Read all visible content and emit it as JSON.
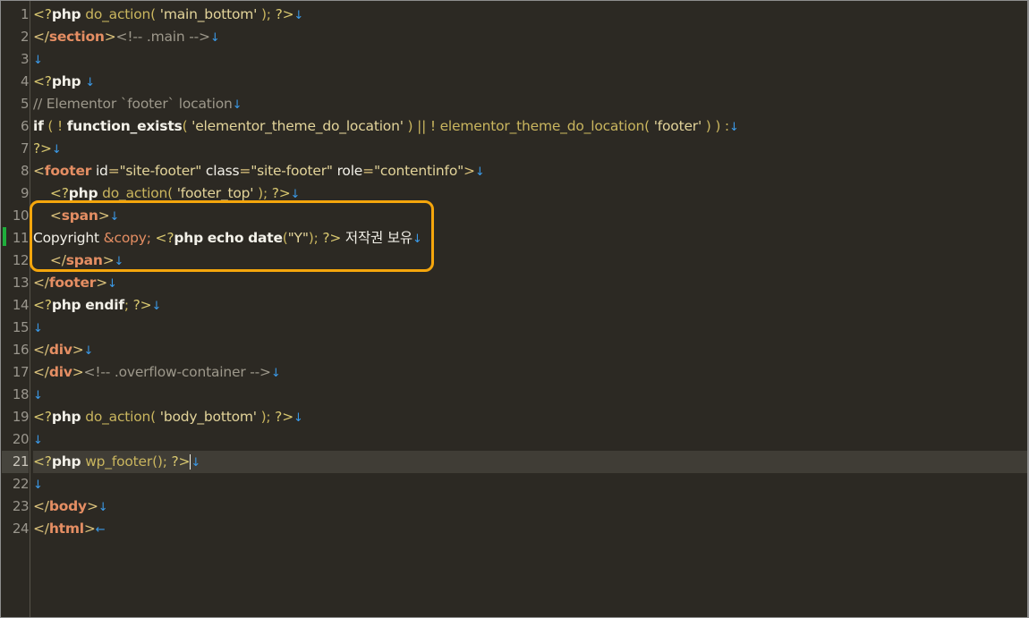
{
  "editor": {
    "active_line": 21,
    "line_numbers": [
      "1",
      "2",
      "3",
      "4",
      "5",
      "6",
      "7",
      "8",
      "9",
      "10",
      "11",
      "12",
      "13",
      "14",
      "15",
      "16",
      "17",
      "18",
      "19",
      "20",
      "21",
      "22",
      "23",
      "24"
    ],
    "eol_glyph": "↓",
    "eof_glyph": "←",
    "lines": [
      {
        "tokens": [
          {
            "c": "pt",
            "t": "<?"
          },
          {
            "c": "kw",
            "t": "php"
          },
          {
            "c": "fn",
            "t": " do_action( "
          },
          {
            "c": "str",
            "t": "'main_bottom'"
          },
          {
            "c": "fn",
            "t": " ); "
          },
          {
            "c": "pt",
            "t": "?>"
          }
        ]
      },
      {
        "tokens": [
          {
            "c": "tg",
            "t": "</"
          },
          {
            "c": "tn",
            "t": "section"
          },
          {
            "c": "tg",
            "t": ">"
          },
          {
            "c": "cm",
            "t": "<!-- .main -->"
          }
        ]
      },
      {
        "tokens": []
      },
      {
        "tokens": [
          {
            "c": "pt",
            "t": "<?"
          },
          {
            "c": "kw",
            "t": "php"
          },
          {
            "c": "tx",
            "t": " "
          }
        ]
      },
      {
        "tokens": [
          {
            "c": "cm",
            "t": "// Elementor `footer` location"
          }
        ]
      },
      {
        "tokens": [
          {
            "c": "kw",
            "t": "if"
          },
          {
            "c": "fn",
            "t": " ( ! "
          },
          {
            "c": "bfn",
            "t": "function_exists"
          },
          {
            "c": "fn",
            "t": "( "
          },
          {
            "c": "str",
            "t": "'elementor_theme_do_location'"
          },
          {
            "c": "fn",
            "t": " ) || ! elementor_theme_do_location( "
          },
          {
            "c": "str",
            "t": "'footer'"
          },
          {
            "c": "fn",
            "t": " ) ) :"
          }
        ]
      },
      {
        "tokens": [
          {
            "c": "pt",
            "t": "?>"
          }
        ]
      },
      {
        "tokens": [
          {
            "c": "tg",
            "t": "<"
          },
          {
            "c": "tn",
            "t": "footer"
          },
          {
            "c": "an",
            "t": " id"
          },
          {
            "c": "tg",
            "t": "="
          },
          {
            "c": "av",
            "t": "\"site-footer\""
          },
          {
            "c": "an",
            "t": " class"
          },
          {
            "c": "tg",
            "t": "="
          },
          {
            "c": "av",
            "t": "\"site-footer\""
          },
          {
            "c": "an",
            "t": " role"
          },
          {
            "c": "tg",
            "t": "="
          },
          {
            "c": "av",
            "t": "\"contentinfo\""
          },
          {
            "c": "tg",
            "t": ">"
          }
        ]
      },
      {
        "tokens": [
          {
            "c": "tx",
            "t": "    "
          },
          {
            "c": "pt",
            "t": "<?"
          },
          {
            "c": "kw",
            "t": "php"
          },
          {
            "c": "fn",
            "t": " do_action( "
          },
          {
            "c": "str",
            "t": "'footer_top'"
          },
          {
            "c": "fn",
            "t": " ); "
          },
          {
            "c": "pt",
            "t": "?>"
          }
        ]
      },
      {
        "tokens": [
          {
            "c": "tx",
            "t": "    "
          },
          {
            "c": "tg",
            "t": "<"
          },
          {
            "c": "tn",
            "t": "span"
          },
          {
            "c": "tg",
            "t": ">"
          }
        ]
      },
      {
        "tokens": [
          {
            "c": "tx",
            "t": "Copyright "
          },
          {
            "c": "ent",
            "t": "&copy;"
          },
          {
            "c": "tx",
            "t": " "
          },
          {
            "c": "pt",
            "t": "<?"
          },
          {
            "c": "kw",
            "t": "php"
          },
          {
            "c": "tx",
            "t": " "
          },
          {
            "c": "bfn",
            "t": "echo"
          },
          {
            "c": "tx",
            "t": " "
          },
          {
            "c": "bfn",
            "t": "date"
          },
          {
            "c": "fn",
            "t": "("
          },
          {
            "c": "str",
            "t": "\"Y\""
          },
          {
            "c": "fn",
            "t": "); "
          },
          {
            "c": "pt",
            "t": "?>"
          },
          {
            "c": "tx",
            "t": " 저작권 보유"
          }
        ]
      },
      {
        "tokens": [
          {
            "c": "tx",
            "t": "    "
          },
          {
            "c": "tg",
            "t": "</"
          },
          {
            "c": "tn",
            "t": "span"
          },
          {
            "c": "tg",
            "t": ">"
          }
        ]
      },
      {
        "tokens": [
          {
            "c": "tg",
            "t": "</"
          },
          {
            "c": "tn",
            "t": "footer"
          },
          {
            "c": "tg",
            "t": ">"
          }
        ]
      },
      {
        "tokens": [
          {
            "c": "pt",
            "t": "<?"
          },
          {
            "c": "kw",
            "t": "php"
          },
          {
            "c": "tx",
            "t": " "
          },
          {
            "c": "kw",
            "t": "endif"
          },
          {
            "c": "fn",
            "t": "; "
          },
          {
            "c": "pt",
            "t": "?>"
          }
        ]
      },
      {
        "tokens": []
      },
      {
        "tokens": [
          {
            "c": "tg",
            "t": "</"
          },
          {
            "c": "tn",
            "t": "div"
          },
          {
            "c": "tg",
            "t": ">"
          }
        ]
      },
      {
        "tokens": [
          {
            "c": "tg",
            "t": "</"
          },
          {
            "c": "tn",
            "t": "div"
          },
          {
            "c": "tg",
            "t": ">"
          },
          {
            "c": "cm",
            "t": "<!-- .overflow-container -->"
          }
        ]
      },
      {
        "tokens": []
      },
      {
        "tokens": [
          {
            "c": "pt",
            "t": "<?"
          },
          {
            "c": "kw",
            "t": "php"
          },
          {
            "c": "fn",
            "t": " do_action( "
          },
          {
            "c": "str",
            "t": "'body_bottom'"
          },
          {
            "c": "fn",
            "t": " ); "
          },
          {
            "c": "pt",
            "t": "?>"
          }
        ]
      },
      {
        "tokens": []
      },
      {
        "tokens": [
          {
            "c": "pt",
            "t": "<?"
          },
          {
            "c": "kw",
            "t": "php"
          },
          {
            "c": "fn",
            "t": " wp_footer(); "
          },
          {
            "c": "pt",
            "t": "?>"
          }
        ]
      },
      {
        "tokens": []
      },
      {
        "tokens": [
          {
            "c": "tg",
            "t": "</"
          },
          {
            "c": "tn",
            "t": "body"
          },
          {
            "c": "tg",
            "t": ">"
          }
        ]
      },
      {
        "tokens": [
          {
            "c": "tg",
            "t": "</"
          },
          {
            "c": "tn",
            "t": "html"
          },
          {
            "c": "tg",
            "t": ">"
          }
        ]
      }
    ]
  },
  "colors": {
    "highlight_box": "#f5a60c",
    "change_marker": "#1fae3c",
    "background": "#2c2923"
  }
}
